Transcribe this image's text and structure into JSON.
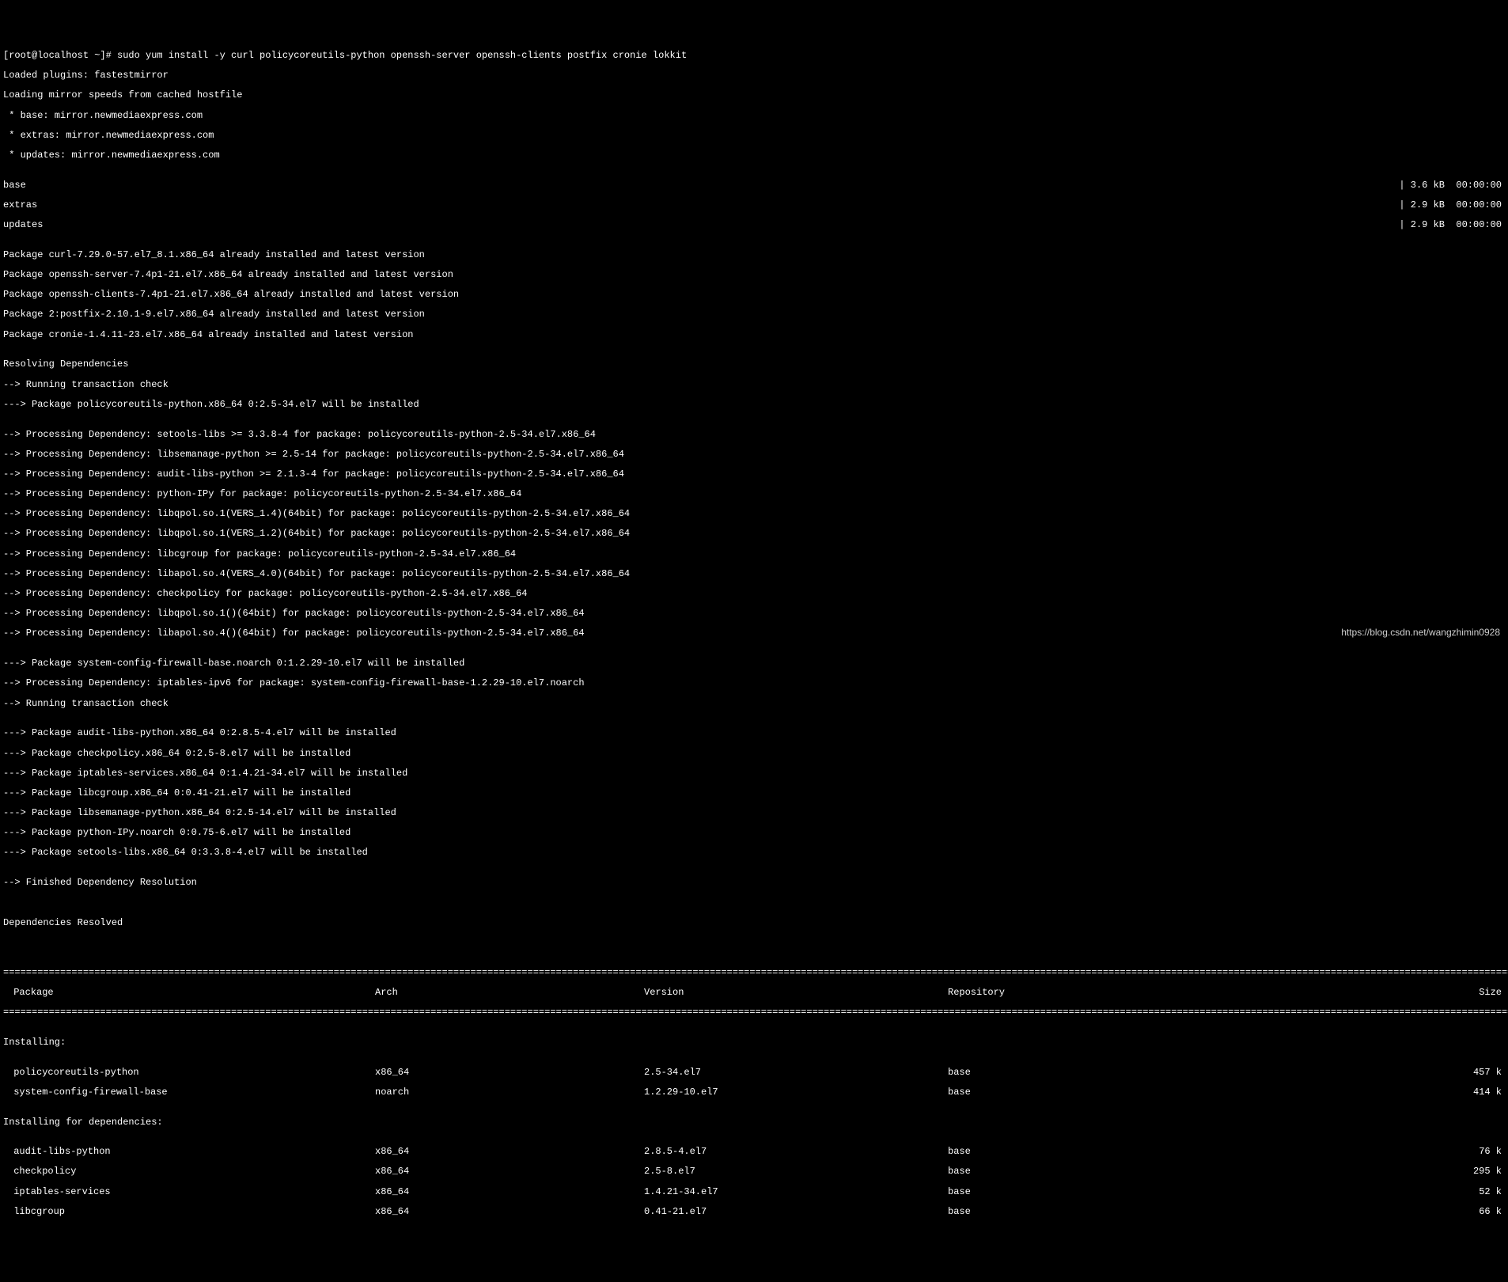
{
  "prompt": "[root@localhost ~]# sudo yum install -y curl policycoreutils-python openssh-server openssh-clients postfix cronie lokkit",
  "plugins": "Loaded plugins: fastestmirror",
  "mirror_speed": "Loading mirror speeds from cached hostfile",
  "mirrors": {
    "base": " * base: mirror.newmediaexpress.com",
    "extras": " * extras: mirror.newmediaexpress.com",
    "updates": " * updates: mirror.newmediaexpress.com"
  },
  "repos": [
    {
      "name": "base",
      "meta": "| 3.6 kB  00:00:00"
    },
    {
      "name": "extras",
      "meta": "| 2.9 kB  00:00:00"
    },
    {
      "name": "updates",
      "meta": "| 2.9 kB  00:00:00"
    }
  ],
  "installed_msgs": [
    "Package curl-7.29.0-57.el7_8.1.x86_64 already installed and latest version",
    "Package openssh-server-7.4p1-21.el7.x86_64 already installed and latest version",
    "Package openssh-clients-7.4p1-21.el7.x86_64 already installed and latest version",
    "Package 2:postfix-2.10.1-9.el7.x86_64 already installed and latest version",
    "Package cronie-1.4.11-23.el7.x86_64 already installed and latest version"
  ],
  "resolve_hdr": "Resolving Dependencies",
  "txn_check1": "--> Running transaction check",
  "pkg_line1": "---> Package policycoreutils-python.x86_64 0:2.5-34.el7 will be installed",
  "deps1": [
    "--> Processing Dependency: setools-libs >= 3.3.8-4 for package: policycoreutils-python-2.5-34.el7.x86_64",
    "--> Processing Dependency: libsemanage-python >= 2.5-14 for package: policycoreutils-python-2.5-34.el7.x86_64",
    "--> Processing Dependency: audit-libs-python >= 2.1.3-4 for package: policycoreutils-python-2.5-34.el7.x86_64",
    "--> Processing Dependency: python-IPy for package: policycoreutils-python-2.5-34.el7.x86_64",
    "--> Processing Dependency: libqpol.so.1(VERS_1.4)(64bit) for package: policycoreutils-python-2.5-34.el7.x86_64",
    "--> Processing Dependency: libqpol.so.1(VERS_1.2)(64bit) for package: policycoreutils-python-2.5-34.el7.x86_64",
    "--> Processing Dependency: libcgroup for package: policycoreutils-python-2.5-34.el7.x86_64",
    "--> Processing Dependency: libapol.so.4(VERS_4.0)(64bit) for package: policycoreutils-python-2.5-34.el7.x86_64",
    "--> Processing Dependency: checkpolicy for package: policycoreutils-python-2.5-34.el7.x86_64",
    "--> Processing Dependency: libqpol.so.1()(64bit) for package: policycoreutils-python-2.5-34.el7.x86_64",
    "--> Processing Dependency: libapol.so.4()(64bit) for package: policycoreutils-python-2.5-34.el7.x86_64"
  ],
  "pkg_line2": "---> Package system-config-firewall-base.noarch 0:1.2.29-10.el7 will be installed",
  "deps2": [
    "--> Processing Dependency: iptables-ipv6 for package: system-config-firewall-base-1.2.29-10.el7.noarch"
  ],
  "txn_check2": "--> Running transaction check",
  "pkg_lines3": [
    "---> Package audit-libs-python.x86_64 0:2.8.5-4.el7 will be installed",
    "---> Package checkpolicy.x86_64 0:2.5-8.el7 will be installed",
    "---> Package iptables-services.x86_64 0:1.4.21-34.el7 will be installed",
    "---> Package libcgroup.x86_64 0:0.41-21.el7 will be installed",
    "---> Package libsemanage-python.x86_64 0:2.5-14.el7 will be installed",
    "---> Package python-IPy.noarch 0:0.75-6.el7 will be installed",
    "---> Package setools-libs.x86_64 0:3.3.8-4.el7 will be installed"
  ],
  "finished": "--> Finished Dependency Resolution",
  "deps_resolved": "Dependencies Resolved",
  "table_hdr": {
    "pkg": " Package",
    "arch": "Arch",
    "ver": "Version",
    "repo": "Repository",
    "size": "Size"
  },
  "installing_hdr": "Installing:",
  "installing": [
    {
      "pkg": " policycoreutils-python",
      "arch": "x86_64",
      "ver": "2.5-34.el7",
      "repo": "base",
      "size": "457 k"
    },
    {
      "pkg": " system-config-firewall-base",
      "arch": "noarch",
      "ver": "1.2.29-10.el7",
      "repo": "base",
      "size": "414 k"
    }
  ],
  "deps_hdr": "Installing for dependencies:",
  "dep_rows": [
    {
      "pkg": " audit-libs-python",
      "arch": "x86_64",
      "ver": "2.8.5-4.el7",
      "repo": "base",
      "size": "76 k"
    },
    {
      "pkg": " checkpolicy",
      "arch": "x86_64",
      "ver": "2.5-8.el7",
      "repo": "base",
      "size": "295 k"
    },
    {
      "pkg": " iptables-services",
      "arch": "x86_64",
      "ver": "1.4.21-34.el7",
      "repo": "base",
      "size": "52 k"
    },
    {
      "pkg": " libcgroup",
      "arch": "x86_64",
      "ver": "0.41-21.el7",
      "repo": "base",
      "size": "66 k"
    }
  ],
  "watermark": "https://blog.csdn.net/wangzhimin0928"
}
